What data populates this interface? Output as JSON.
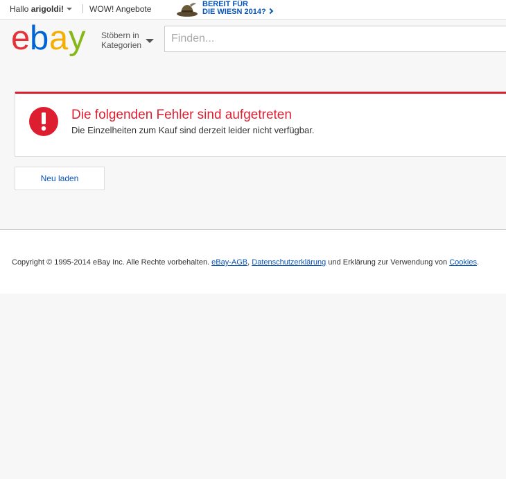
{
  "topbar": {
    "greeting_prefix": "Hallo ",
    "username": "arigoldi!",
    "wow_link": "WOW! Angebote",
    "promo_line1": "BEREIT FÜR",
    "promo_line2": "DIE WIESN 2014?"
  },
  "header": {
    "logo_letters": [
      "e",
      "b",
      "a",
      "y"
    ],
    "logo_colors": [
      "#e53238",
      "#0064d2",
      "#f5af02",
      "#86b817"
    ],
    "browse_line1": "Stöbern in",
    "browse_line2": "Kategorien",
    "search_placeholder": "Finden..."
  },
  "error": {
    "title": "Die folgenden Fehler sind aufgetreten",
    "message": "Die Einzelheiten zum Kauf sind derzeit leider nicht verfügbar.",
    "icon": "exclamation-icon",
    "color": "#dd1e31"
  },
  "actions": {
    "reload_label": "Neu laden"
  },
  "footer": {
    "copyright_text": "Copyright © 1995-2014 eBay Inc. Alle Rechte vorbehalten. ",
    "agb_link": "eBay-AGB",
    "comma": ", ",
    "privacy_link": "Datenschutzerklärung",
    "middle_text": " und Erklärung zur Verwendung von ",
    "cookies_link": "Cookies",
    "end_text": "."
  },
  "colors": {
    "link": "#0654ba",
    "error_red": "#dd1e31",
    "background": "#f7f7f7"
  }
}
